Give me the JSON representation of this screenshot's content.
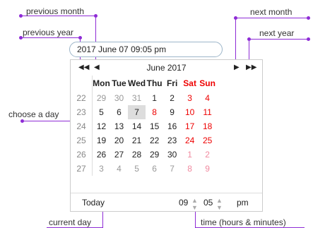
{
  "annotations": {
    "previous_month": "previous month",
    "next_month": "next month",
    "previous_year": "previous year",
    "next_year": "next year",
    "choose_day": "choose a day",
    "current_day": "current day",
    "time": "time (hours & minutes)"
  },
  "input": {
    "value": "2017 June 07 09:05 pm"
  },
  "calendar": {
    "title": "June 2017",
    "prev_year_icon": "double-left-arrow",
    "prev_month_icon": "left-arrow",
    "next_month_icon": "right-arrow",
    "next_year_icon": "double-right-arrow",
    "weekdays": [
      "Mon",
      "Tue",
      "Wed",
      "Thu",
      "Fri",
      "Sat",
      "Sun"
    ],
    "weeks": [
      {
        "wk": "22",
        "days": [
          "29",
          "30",
          "31",
          "1",
          "2",
          "3",
          "4"
        ]
      },
      {
        "wk": "23",
        "days": [
          "5",
          "6",
          "7",
          "8",
          "9",
          "10",
          "11"
        ]
      },
      {
        "wk": "24",
        "days": [
          "12",
          "13",
          "14",
          "15",
          "16",
          "17",
          "18"
        ]
      },
      {
        "wk": "25",
        "days": [
          "19",
          "20",
          "21",
          "22",
          "23",
          "24",
          "25"
        ]
      },
      {
        "wk": "26",
        "days": [
          "26",
          "27",
          "28",
          "29",
          "30",
          "1",
          "2"
        ]
      },
      {
        "wk": "27",
        "days": [
          "3",
          "4",
          "5",
          "6",
          "7",
          "8",
          "9"
        ]
      }
    ],
    "selected_day": "7",
    "today_label": "Today",
    "hours": "09",
    "minutes": "05",
    "ampm": "pm"
  },
  "colors": {
    "annotation_line": "#8e2bd6",
    "weekend": "#e00000"
  }
}
